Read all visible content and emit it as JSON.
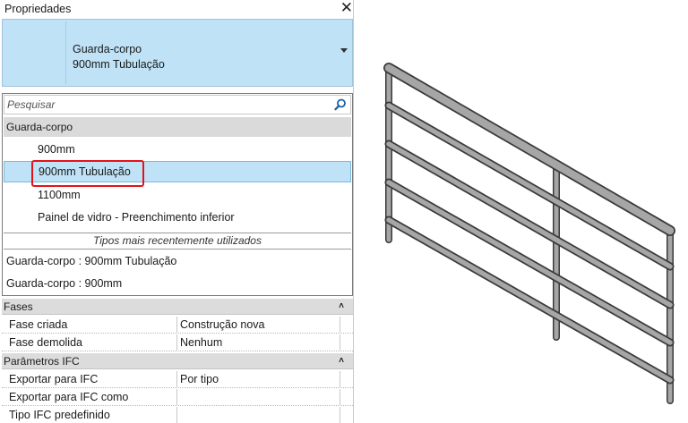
{
  "panel": {
    "title": "Propriedades",
    "close_icon": "close-icon"
  },
  "type_selector": {
    "family": "Guarda-corpo",
    "type": "900mm Tubulação"
  },
  "dropdown": {
    "search_placeholder": "Pesquisar",
    "group_label": "Guarda-corpo",
    "items": [
      {
        "label": "900mm"
      },
      {
        "label": "900mm Tubulação",
        "selected": true
      },
      {
        "label": "1100mm"
      },
      {
        "label": "Painel de vidro - Preenchimento inferior"
      }
    ],
    "recent_header": "Tipos mais recentemente utilizados",
    "recent_items": [
      {
        "label": "Guarda-corpo : 900mm Tubulação"
      },
      {
        "label": "Guarda-corpo : 900mm"
      }
    ]
  },
  "properties": {
    "sections": [
      {
        "title": "Fases",
        "rows": [
          {
            "name": "Fase criada",
            "value": "Construção nova"
          },
          {
            "name": "Fase demolida",
            "value": "Nenhum"
          }
        ]
      },
      {
        "title": "Parâmetros IFC",
        "rows": [
          {
            "name": "Exportar para IFC",
            "value": "Por tipo"
          },
          {
            "name": "Exportar para IFC como",
            "value": ""
          },
          {
            "name": "Tipo IFC predefinido",
            "value": ""
          }
        ]
      }
    ]
  },
  "colors": {
    "selection_fill": "#bfe2f6",
    "selection_border": "#7cb8dc",
    "highlight_red": "#e3131b",
    "rail_gray": "#a6a6a6"
  }
}
